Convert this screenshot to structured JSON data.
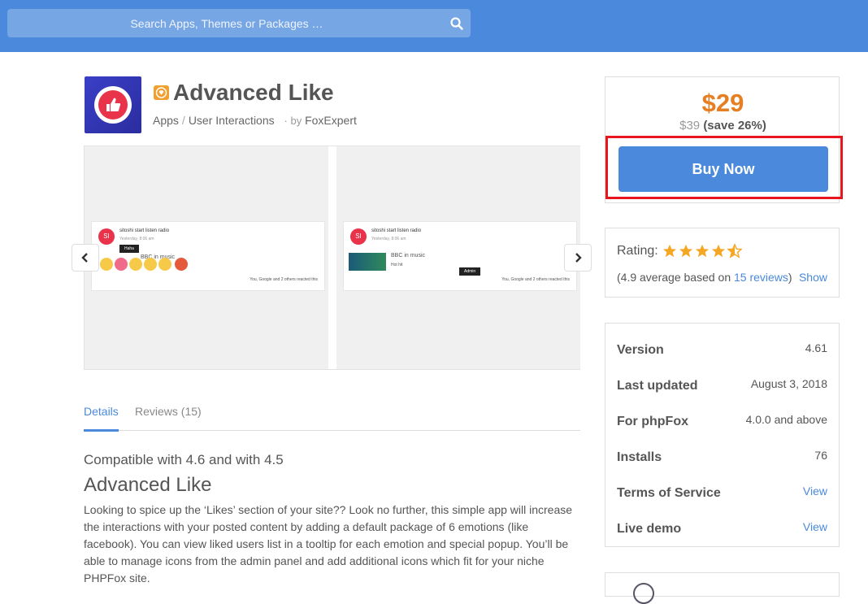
{
  "search": {
    "placeholder": "Search Apps, Themes or Packages …"
  },
  "product": {
    "title": "Advanced Like",
    "breadcrumb": [
      "Apps",
      "User Interactions"
    ],
    "by_label": "· by",
    "author": "FoxExpert"
  },
  "gallery": {
    "slides": [
      {
        "user": "SI",
        "name": "sitoshi start listen radio",
        "time": "Yesterday, 8:06 am",
        "tooltip": "Haha",
        "post_text": "BBC in music",
        "reactions": "You, Google and 2 others reacted this"
      },
      {
        "user": "SI",
        "name": "sitoshi start listen radio",
        "time": "Yesterday, 8:06 am",
        "tooltip": "Admin",
        "post_text": "BBC in music",
        "post_sub": "Hot hit",
        "reactions": "You, Google and 2 others reacted this"
      }
    ]
  },
  "tabs": [
    {
      "label": "Details",
      "active": true
    },
    {
      "label": "Reviews (15)",
      "active": false
    }
  ],
  "details": {
    "compatibility": "Compatible with 4.6 and with 4.5",
    "heading": "Advanced Like",
    "description": "Looking to spice up the ‘Likes’ section of your site?? Look no further, this simple app will increase the interactions with your posted content by adding a default package of 6 emotions (like facebook). You can view liked users list in a tooltip for each emotion and special popup. You’ll be able to manage icons from the admin panel and add additional icons which fit for your niche PHPFox site."
  },
  "pricing": {
    "price": "$29",
    "old_price": "$39",
    "save": "(save 26%)",
    "buy_label": "Buy Now"
  },
  "rating": {
    "label": "Rating:",
    "stars": 4.5,
    "text_prefix": "(4.9 average based on ",
    "reviews_link": "15 reviews",
    "text_suffix": ")",
    "show_label": "Show"
  },
  "info": [
    {
      "key": "Version",
      "value": "4.61",
      "link": false
    },
    {
      "key": "Last updated",
      "value": "August 3, 2018",
      "link": false
    },
    {
      "key": "For phpFox",
      "value": "4.0.0 and above",
      "link": false
    },
    {
      "key": "Installs",
      "value": "76",
      "link": false
    },
    {
      "key": "Terms of Service",
      "value": "View",
      "link": true
    },
    {
      "key": "Live demo",
      "value": "View",
      "link": true
    }
  ],
  "colors": {
    "accent": "#4a89dc",
    "price": "#e67e22",
    "highlight": "#e8141e"
  }
}
